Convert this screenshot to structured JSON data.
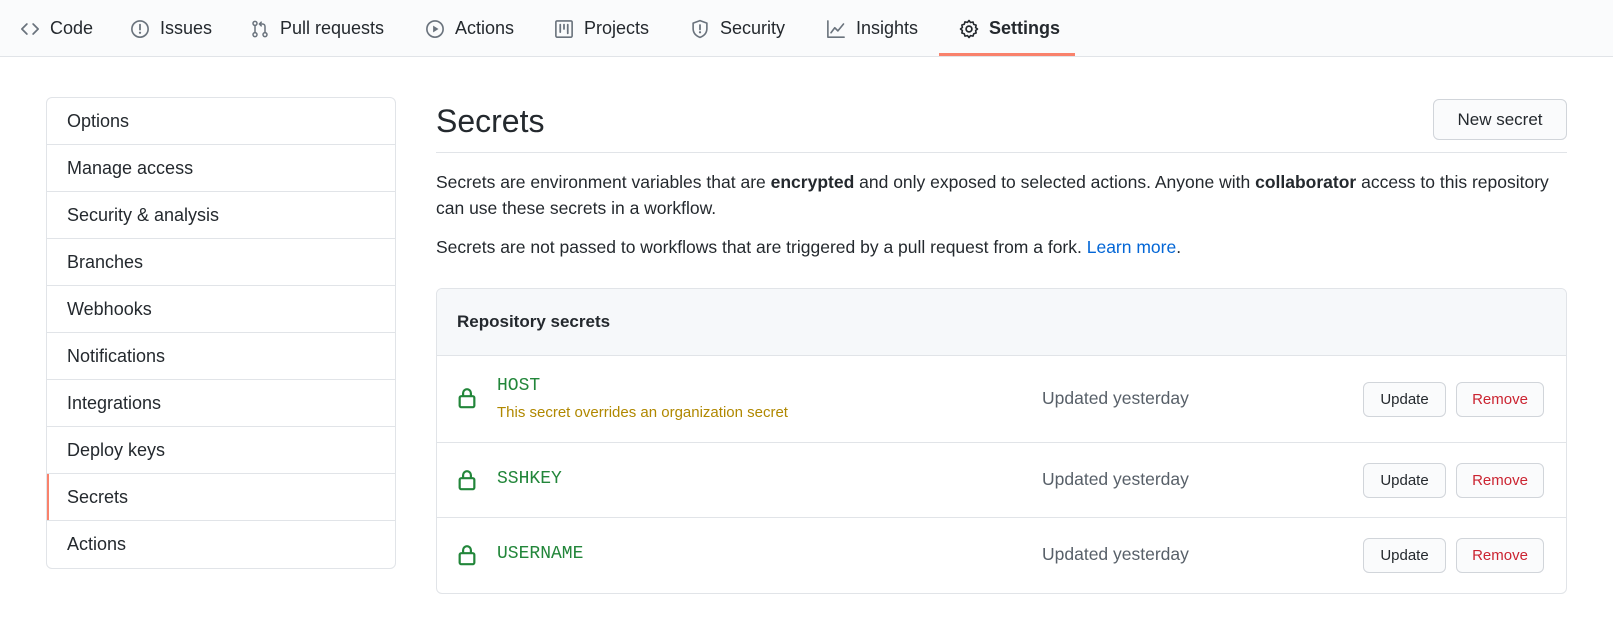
{
  "nav": {
    "tabs": [
      {
        "label": "Code",
        "icon": "code-icon"
      },
      {
        "label": "Issues",
        "icon": "issue-opened-icon"
      },
      {
        "label": "Pull requests",
        "icon": "git-pull-request-icon"
      },
      {
        "label": "Actions",
        "icon": "play-icon"
      },
      {
        "label": "Projects",
        "icon": "project-icon"
      },
      {
        "label": "Security",
        "icon": "shield-icon"
      },
      {
        "label": "Insights",
        "icon": "graph-icon"
      },
      {
        "label": "Settings",
        "icon": "gear-icon",
        "active": true
      }
    ],
    "active_underline_color": "#f9826c"
  },
  "sidebar": {
    "items": [
      {
        "label": "Options"
      },
      {
        "label": "Manage access"
      },
      {
        "label": "Security & analysis"
      },
      {
        "label": "Branches"
      },
      {
        "label": "Webhooks"
      },
      {
        "label": "Notifications"
      },
      {
        "label": "Integrations"
      },
      {
        "label": "Deploy keys"
      },
      {
        "label": "Secrets",
        "selected": true
      },
      {
        "label": "Actions"
      }
    ]
  },
  "main": {
    "title": "Secrets",
    "new_secret_label": "New secret",
    "desc1": {
      "p1": "Secrets are environment variables that are ",
      "b1": "encrypted",
      "p2": " and only exposed to selected actions. Anyone with ",
      "b2": "collaborator",
      "p3": " access to this repository can use these secrets in a workflow."
    },
    "desc2": {
      "text": "Secrets are not passed to workflows that are triggered by a pull request from a fork. ",
      "link": "Learn more",
      "end": "."
    },
    "repo_secrets": {
      "header": "Repository secrets",
      "rows": [
        {
          "name": "HOST",
          "note": "This secret overrides an organization secret",
          "updated": "Updated yesterday",
          "update_label": "Update",
          "remove_label": "Remove"
        },
        {
          "name": "SSHKEY",
          "updated": "Updated yesterday",
          "update_label": "Update",
          "remove_label": "Remove"
        },
        {
          "name": "USERNAME",
          "updated": "Updated yesterday",
          "update_label": "Update",
          "remove_label": "Remove"
        }
      ]
    }
  },
  "colors": {
    "accent": "#f9826c",
    "secret_green": "#22863a",
    "warning": "#b08800",
    "danger": "#cb2431",
    "link": "#0366d6"
  }
}
